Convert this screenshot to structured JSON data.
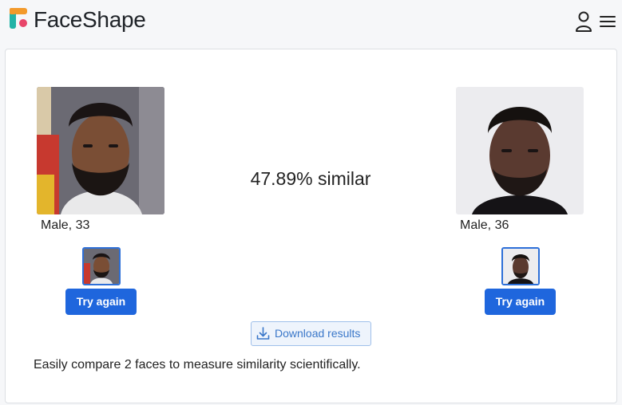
{
  "header": {
    "brand": "FaceShape",
    "icons": {
      "logo": "faceshape-logo",
      "user": "user-icon",
      "menu": "menu-icon"
    }
  },
  "comparison": {
    "left": {
      "info": "Male, 33",
      "retry_label": "Try again"
    },
    "right": {
      "info": "Male, 36",
      "retry_label": "Try again"
    },
    "similarity": "47.89% similar",
    "download_label": "Download results"
  },
  "footer": {
    "tagline": "Easily compare 2 faces to measure similarity scientifically."
  },
  "colors": {
    "accent": "#1f66dd",
    "download_text": "#3a77c9",
    "logo_orange": "#f39a2b",
    "logo_teal": "#23b3a7",
    "logo_pink": "#e8466a"
  }
}
